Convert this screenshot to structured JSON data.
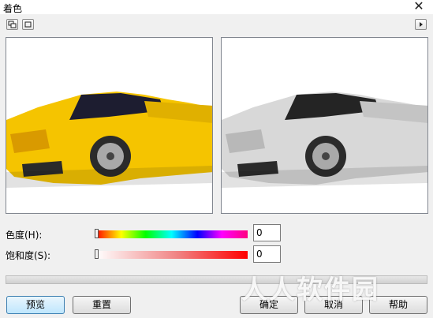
{
  "window": {
    "title": "着色",
    "close_glyph": "✕"
  },
  "toolbar": {
    "left_icons": [
      "copy-view-icon",
      "single-view-icon"
    ],
    "right_icon": "play-arrow-icon"
  },
  "previews": {
    "original": {
      "image": "yellow-sports-car",
      "color": "#f5c400"
    },
    "result": {
      "image": "grayscale-sports-car",
      "color": "#d8d8d8"
    }
  },
  "hue": {
    "label": "色度(H):",
    "value": "0",
    "slider_fraction": 0
  },
  "saturation": {
    "label": "饱和度(S):",
    "value": "0",
    "slider_fraction": 0
  },
  "buttons": {
    "preview": "预览",
    "reset": "重置",
    "ok": "确定",
    "cancel": "取消",
    "help": "帮助"
  },
  "watermark": "人人软件园",
  "colors": {
    "default_button_border": "#3c7fb1",
    "background": "#f0f0f0"
  }
}
